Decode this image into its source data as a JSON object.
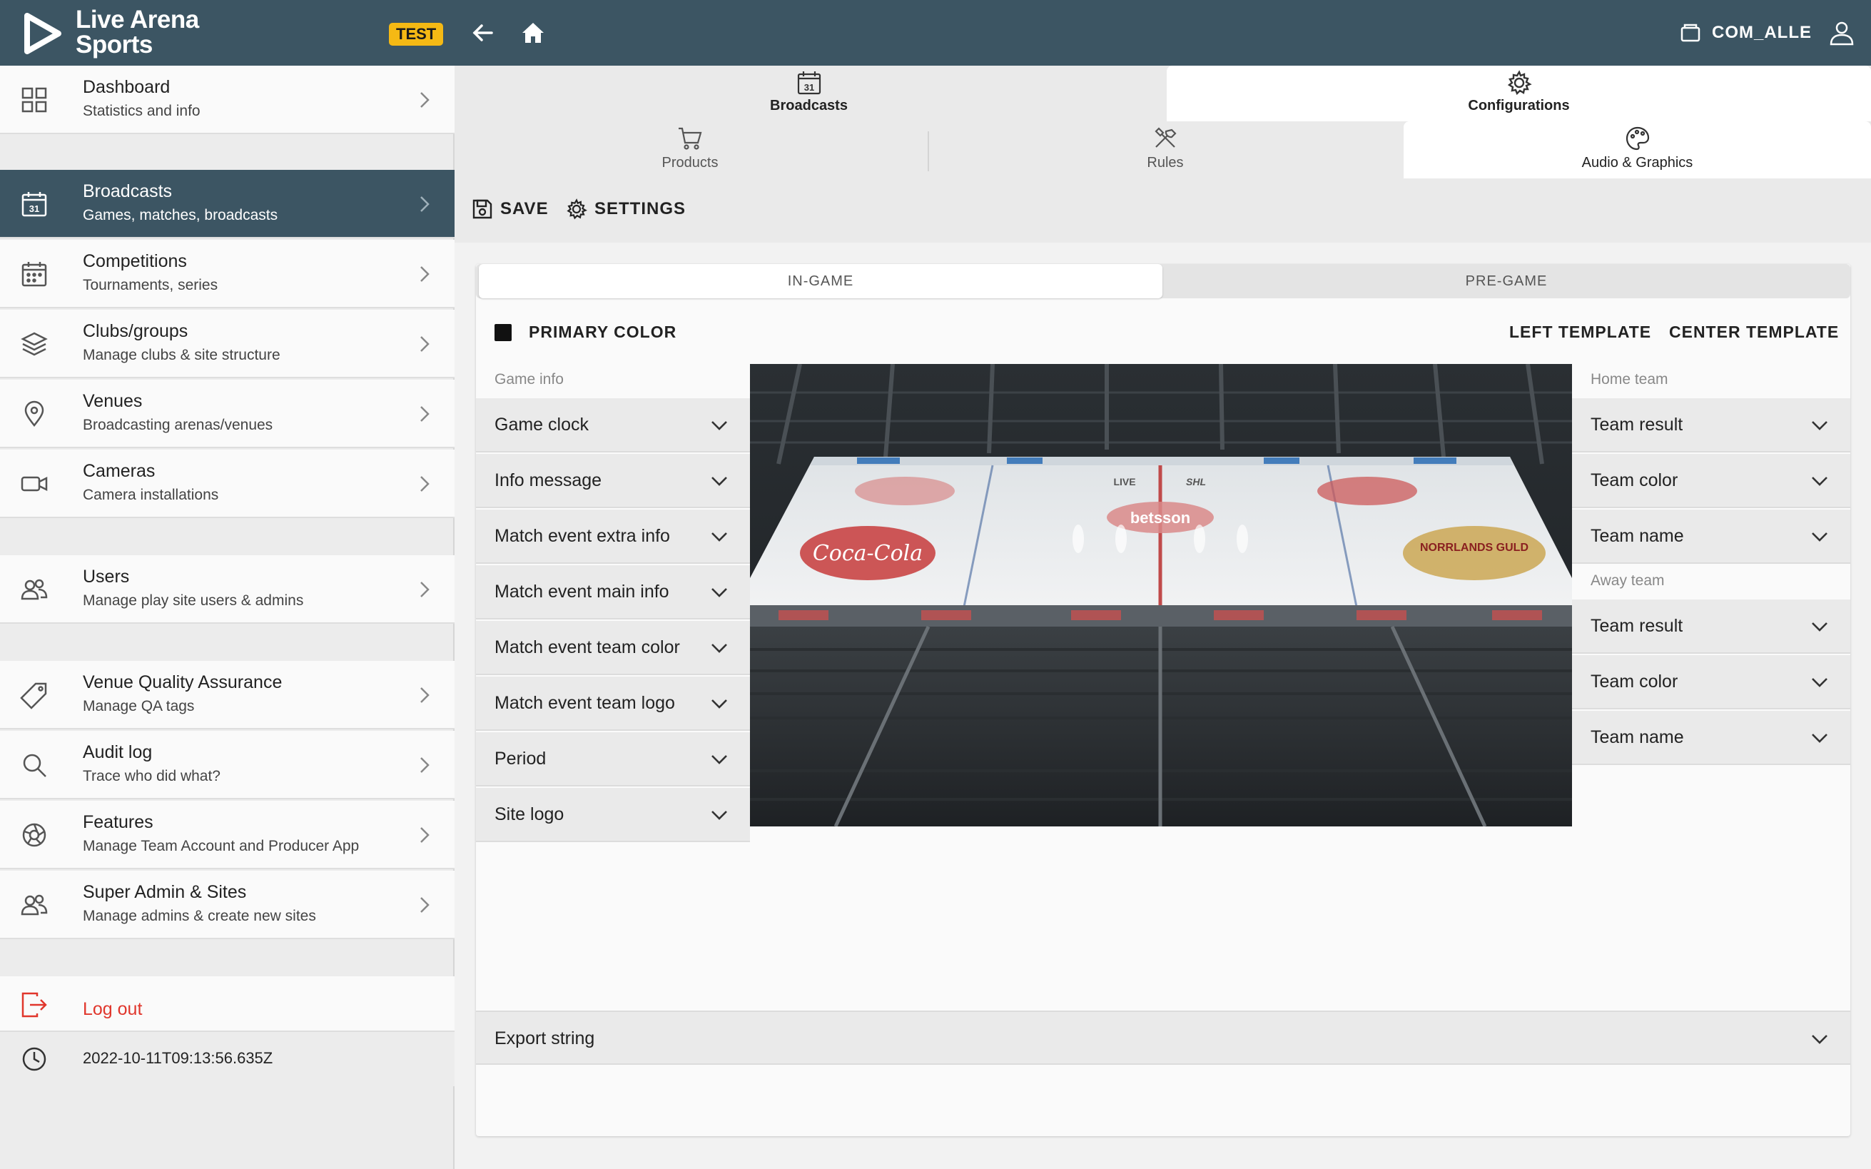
{
  "brand": {
    "line1": "Live Arena",
    "line2": "Sports",
    "badge": "TEST"
  },
  "sidebar": {
    "items": [
      {
        "title": "Dashboard",
        "subtitle": "Statistics and info",
        "icon": "grid-icon"
      },
      {
        "title": "Broadcasts",
        "subtitle": "Games, matches, broadcasts",
        "icon": "calendar-31-icon"
      },
      {
        "title": "Competitions",
        "subtitle": "Tournaments, series",
        "icon": "calendar-icon"
      },
      {
        "title": "Clubs/groups",
        "subtitle": "Manage clubs & site structure",
        "icon": "layers-icon"
      },
      {
        "title": "Venues",
        "subtitle": "Broadcasting arenas/venues",
        "icon": "location-pin-icon"
      },
      {
        "title": "Cameras",
        "subtitle": "Camera installations",
        "icon": "video-camera-icon"
      },
      {
        "title": "Users",
        "subtitle": "Manage play site users & admins",
        "icon": "users-icon"
      },
      {
        "title": "Venue Quality Assurance",
        "subtitle": "Manage QA tags",
        "icon": "tag-icon"
      },
      {
        "title": "Audit log",
        "subtitle": "Trace who did what?",
        "icon": "search-icon"
      },
      {
        "title": "Features",
        "subtitle": "Manage Team Account and Producer App",
        "icon": "aperture-icon"
      },
      {
        "title": "Super Admin & Sites",
        "subtitle": "Manage admins & create new sites",
        "icon": "users-icon"
      }
    ],
    "logout": "Log out",
    "timestamp": "2022-10-11T09:13:56.635Z"
  },
  "topbar": {
    "account": "COM_ALLE"
  },
  "tabs": {
    "main": [
      {
        "label": "Broadcasts",
        "day": "31"
      },
      {
        "label": "Configurations"
      }
    ],
    "sub": [
      {
        "label": "Products"
      },
      {
        "label": "Rules"
      },
      {
        "label": "Audio & Graphics"
      }
    ]
  },
  "toolbar": {
    "save": "SAVE",
    "settings": "SETTINGS"
  },
  "editor": {
    "modes": [
      "IN-GAME",
      "PRE-GAME"
    ],
    "primary_color": {
      "label": "PRIMARY COLOR",
      "value": "#111111"
    },
    "templates": [
      "LEFT TEMPLATE",
      "CENTER TEMPLATE"
    ],
    "game_info": {
      "heading": "Game info",
      "items": [
        "Game clock",
        "Info message",
        "Match event extra info",
        "Match event main info",
        "Match event team color",
        "Match event team logo",
        "Period",
        "Site logo"
      ]
    },
    "home_team": {
      "heading": "Home team",
      "items": [
        "Team result",
        "Team color",
        "Team name"
      ]
    },
    "away_team": {
      "heading": "Away team",
      "items": [
        "Team result",
        "Team color",
        "Team name"
      ]
    },
    "export": "Export string"
  },
  "preview": {
    "rink_ads": [
      "Coca-Cola",
      "betsson",
      "LIVE",
      "SHL",
      "NORRLANDS GULD"
    ]
  },
  "colors": {
    "header": "#3c5563",
    "accent_badge": "#f5b914",
    "logout": "#e0362c"
  }
}
